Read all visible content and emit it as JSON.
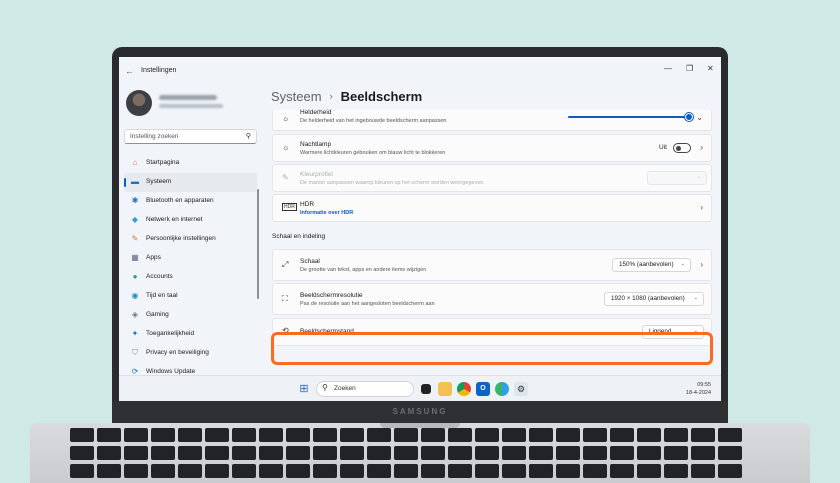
{
  "window": {
    "title": "Instellingen",
    "back": "←",
    "minimize": "—",
    "maximize": "❐",
    "close": "✕"
  },
  "sidebar": {
    "search_placeholder": "Instelling zoeken",
    "items": [
      {
        "label": "Startpagina",
        "icon": "home-icon",
        "color": "#e0794a"
      },
      {
        "label": "Systeem",
        "icon": "system-icon",
        "color": "#1c6fd1"
      },
      {
        "label": "Bluetooth en apparaten",
        "icon": "bluetooth-icon",
        "color": "#1c6fd1"
      },
      {
        "label": "Netwerk en internet",
        "icon": "wifi-icon",
        "color": "#2da0e6"
      },
      {
        "label": "Persoonlijke instellingen",
        "icon": "brush-icon",
        "color": "#d9772d"
      },
      {
        "label": "Apps",
        "icon": "apps-icon",
        "color": "#5b6a80"
      },
      {
        "label": "Accounts",
        "icon": "accounts-icon",
        "color": "#2ca55a"
      },
      {
        "label": "Tijd en taal",
        "icon": "globe-icon",
        "color": "#1b8fd6"
      },
      {
        "label": "Gaming",
        "icon": "gaming-icon",
        "color": "#6b7785"
      },
      {
        "label": "Toegankelijkheid",
        "icon": "accessibility-icon",
        "color": "#1c6fd1"
      },
      {
        "label": "Privacy en beveiliging",
        "icon": "shield-icon",
        "color": "#7f8896"
      },
      {
        "label": "Windows Update",
        "icon": "update-icon",
        "color": "#1b7fd6"
      }
    ]
  },
  "breadcrumb": {
    "parent": "Systeem",
    "separator": "›",
    "current": "Beeldscherm"
  },
  "settings": {
    "brightness": {
      "title": "Helderheid",
      "desc": "De helderheid van het ingebouwde beeldscherm aanpassen",
      "level": 1.0
    },
    "nightlight": {
      "title": "Nachtlamp",
      "desc": "Warmere lichtkleuren gebruiken om blauw licht te blokkeren",
      "toggle_label": "Uit"
    },
    "colorprofile": {
      "title": "Kleurprofiel",
      "desc": "De manier aanpassen waarop kleuren op het scherm worden weergegeven"
    },
    "hdr": {
      "title": "HDR",
      "link": "Informatie over HDR",
      "icon_text": "HDR"
    },
    "section_scale": "Schaal en indeling",
    "scale": {
      "title": "Schaal",
      "desc": "De grootte van tekst, apps en andere items wijzigen",
      "value": "150% (aanbevolen)"
    },
    "resolution": {
      "title": "Beeldschermresolutie",
      "desc": "Pas de resolutie aan het aangesloten beeldscherm aan",
      "value": "1920 × 1080 (aanbevolen)"
    },
    "orientation": {
      "title": "Beeldschermstand",
      "value": "Liggend"
    }
  },
  "taskbar": {
    "search_label": "Zoeken",
    "time": "09:55",
    "date": "18-4-2024"
  },
  "device": {
    "brand": "SAMSUNG"
  },
  "colors": {
    "accent": "#0a5cc2",
    "highlight": "#ff6a1f",
    "background": "#cfeae6"
  }
}
